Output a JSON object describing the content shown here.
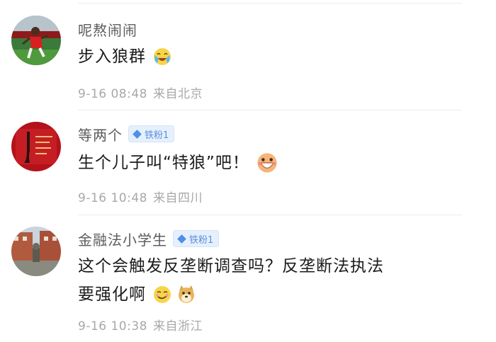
{
  "comments": [
    {
      "username": "呢熬闹闹",
      "badge": null,
      "content_lines": [
        "步入狼群"
      ],
      "emoji": "crying-laugh-emoji",
      "time": "9-16 08:48",
      "location": "来自北京"
    },
    {
      "username": "等两个",
      "badge": "铁粉1",
      "content_lines": [
        "生个儿子叫“特狼”吧！"
      ],
      "emoji": "grin-emoji",
      "time": "9-16 10:48",
      "location": "来自四川"
    },
    {
      "username": "金融法小学生",
      "badge": "铁粉1",
      "content_lines": [
        "这个会触发反垄断调查吗？反垄断法执法",
        "要强化啊"
      ],
      "emojis": [
        "smirk-emoji",
        "doge-emoji"
      ],
      "time": "9-16 10:38",
      "location": "来自浙江"
    }
  ],
  "colors": {
    "username": "#5b5b5b",
    "content": "#1b1b1b",
    "meta": "#a8a8a8",
    "badge_bg": "#e6f0fd",
    "badge_text": "#5d8fd8"
  }
}
